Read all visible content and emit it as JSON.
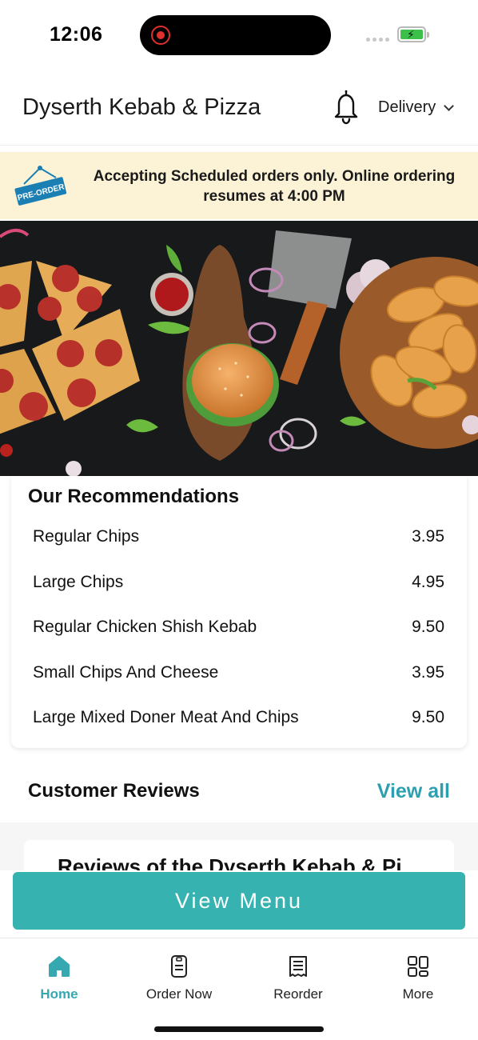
{
  "status_bar": {
    "time": "12:06"
  },
  "header": {
    "store_name": "Dyserth Kebab & Pizza",
    "order_mode": "Delivery"
  },
  "banner": {
    "tag": "PRE-ORDER",
    "message": "Accepting Scheduled orders only. Online ordering resumes at 4:00 PM"
  },
  "recommendations": {
    "title": "Our Recommendations",
    "items": [
      {
        "name": "Regular Chips",
        "price": "3.95"
      },
      {
        "name": "Large Chips",
        "price": "4.95"
      },
      {
        "name": "Regular Chicken Shish Kebab",
        "price": "9.50"
      },
      {
        "name": "Small Chips And Cheese",
        "price": "3.95"
      },
      {
        "name": "Large Mixed Doner Meat And Chips",
        "price": "9.50"
      }
    ]
  },
  "reviews": {
    "title": "Customer Reviews",
    "view_all": "View all",
    "peek_text": "Reviews of the Dyserth Kebab & Pi"
  },
  "cta": {
    "view_menu": "View Menu"
  },
  "tabs": [
    {
      "label": "Home",
      "icon": "home-icon",
      "active": true
    },
    {
      "label": "Order Now",
      "icon": "phone-order-icon",
      "active": false
    },
    {
      "label": "Reorder",
      "icon": "receipt-icon",
      "active": false
    },
    {
      "label": "More",
      "icon": "grid-icon",
      "active": false
    }
  ],
  "colors": {
    "accent": "#36b3b1",
    "link": "#2c9fb0",
    "banner_bg": "#fcf3d7",
    "tag_blue": "#1c7fb3"
  }
}
